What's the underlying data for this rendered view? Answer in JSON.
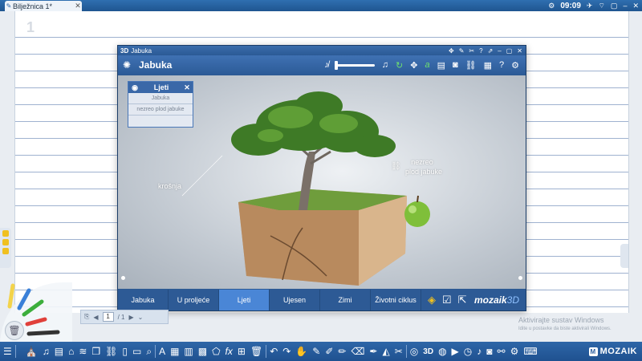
{
  "topbar": {
    "doc_title": "Bilježnica 1*",
    "clock": "09:09",
    "icons": [
      "pen-icon",
      "close-icon",
      "gear-icon",
      "plane-icon",
      "wifi-icon",
      "window-icon",
      "minimize-icon",
      "close-icon"
    ]
  },
  "page": {
    "number": "1"
  },
  "window": {
    "app_logo": "3D",
    "title": "Jabuka",
    "heading": "Jabuka",
    "toolbar_icons": [
      "mute-icon",
      "volume-slider",
      "music-icon",
      "refresh-icon",
      "move-icon",
      "text-icon",
      "book-icon",
      "camera-icon",
      "link-icon",
      "grid-icon",
      "help-icon",
      "settings-icon"
    ],
    "panel": {
      "title": "Ljeti",
      "items": [
        "Jabuka",
        "nezreo plod jabuke"
      ]
    },
    "labels": {
      "crown": "krošnja",
      "fruit_line1": "nezreo",
      "fruit_line2": "plod jabuke"
    },
    "tabs": [
      "Jabuka",
      "U proljeće",
      "Ljeti",
      "Ujesen",
      "Zimi",
      "Životni ciklus"
    ],
    "active_tab": "Ljeti",
    "brand": "mozaik",
    "brand_suffix": "3D"
  },
  "pager": {
    "current": "1",
    "total": "/ 1"
  },
  "watermark": {
    "line1": "Aktivirajte sustav Windows",
    "line2": "Idite u postavke da biste aktivirali Windows."
  },
  "bottom": {
    "brand": "MOZAIK"
  },
  "colors": {
    "accent": "#2d5a95",
    "active_tab": "#4a86d6",
    "topbar": "#2f6fb0"
  }
}
